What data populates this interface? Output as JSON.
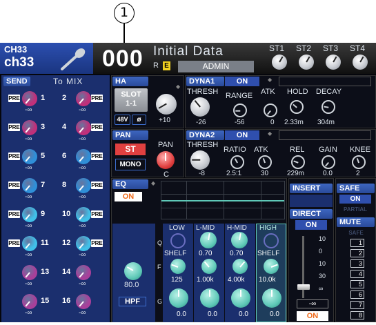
{
  "callout": "1",
  "header": {
    "ch_top": "CH33",
    "ch_bottom": "ch33",
    "scene_number": "000",
    "scene_title": "Initial Data",
    "r_label": "R",
    "e_label": "E",
    "user": "ADMIN",
    "st_labels": [
      "ST1",
      "ST2",
      "ST3",
      "ST4"
    ]
  },
  "send": {
    "title": "SEND",
    "subtitle": "To MIX",
    "pre_label": "PRE",
    "values": [
      "-∞",
      "-∞",
      "-∞",
      "-∞",
      "-∞",
      "-∞",
      "-∞",
      "-∞",
      "-∞",
      "-∞",
      "-∞",
      "-∞",
      "-∞",
      "-∞",
      "-∞",
      "-∞"
    ],
    "numbers": [
      "1",
      "2",
      "3",
      "4",
      "5",
      "6",
      "7",
      "8",
      "9",
      "10",
      "11",
      "12",
      "13",
      "14",
      "15",
      "16"
    ]
  },
  "ha": {
    "title": "HA",
    "slot": "SLOT\n1-1",
    "phantom": "48V",
    "phase": "ø",
    "gain": "+10"
  },
  "pan": {
    "title": "PAN",
    "st": "ST",
    "mono": "MONO",
    "pan_label": "PAN",
    "pan_value": "C"
  },
  "dyna1": {
    "title": "DYNA1",
    "on": "ON",
    "labels": [
      "THRESH",
      "RANGE",
      "ATK",
      "HOLD",
      "DECAY"
    ],
    "values": [
      "-26",
      "-56",
      "0",
      "2.33m",
      "304m"
    ]
  },
  "dyna2": {
    "title": "DYNA2",
    "on": "ON",
    "labels": [
      "THRESH",
      "RATIO",
      "ATK",
      "REL",
      "GAIN",
      "KNEE"
    ],
    "values": [
      "-8",
      "2.5:1",
      "30",
      "229m",
      "0.0",
      "2"
    ]
  },
  "eq": {
    "title": "EQ",
    "on": "ON",
    "bands": [
      "LOW",
      "L-MID",
      "H-MID",
      "HIGH"
    ],
    "row_labels": [
      "Q",
      "F",
      "G"
    ],
    "q_values": [
      "",
      "0.70",
      "0.70",
      ""
    ],
    "shelf": "SHELF",
    "freq": [
      "125",
      "1.00k",
      "4.00k",
      "10.0k"
    ],
    "gain": [
      "0.0",
      "0.0",
      "0.0",
      "0.0"
    ],
    "hpf_value": "80.0",
    "hpf_label": "HPF"
  },
  "insert": {
    "title": "INSERT"
  },
  "direct": {
    "title": "DIRECT",
    "on": "ON"
  },
  "fader": {
    "scale": [
      "10",
      "0",
      "10",
      "30",
      "∞"
    ],
    "value": "-∞",
    "on": "ON"
  },
  "safe": {
    "title": "SAFE",
    "on": "ON",
    "partial": "PARTIAL"
  },
  "mute": {
    "title": "MUTE",
    "safe": "SAFE",
    "groups": [
      "1",
      "2",
      "3",
      "4",
      "5",
      "6",
      "7",
      "8"
    ]
  },
  "colors": {
    "send_magenta": "#c0307a",
    "send_blue": "#2f8fd8",
    "send_cyan": "#40c0e8",
    "send_purple": "#a8409a",
    "eq_teal": "#5fc9b8",
    "on_orange": "#f06a1a",
    "panel_blue": "#1b2f6e",
    "pan_red": "#e04040"
  }
}
